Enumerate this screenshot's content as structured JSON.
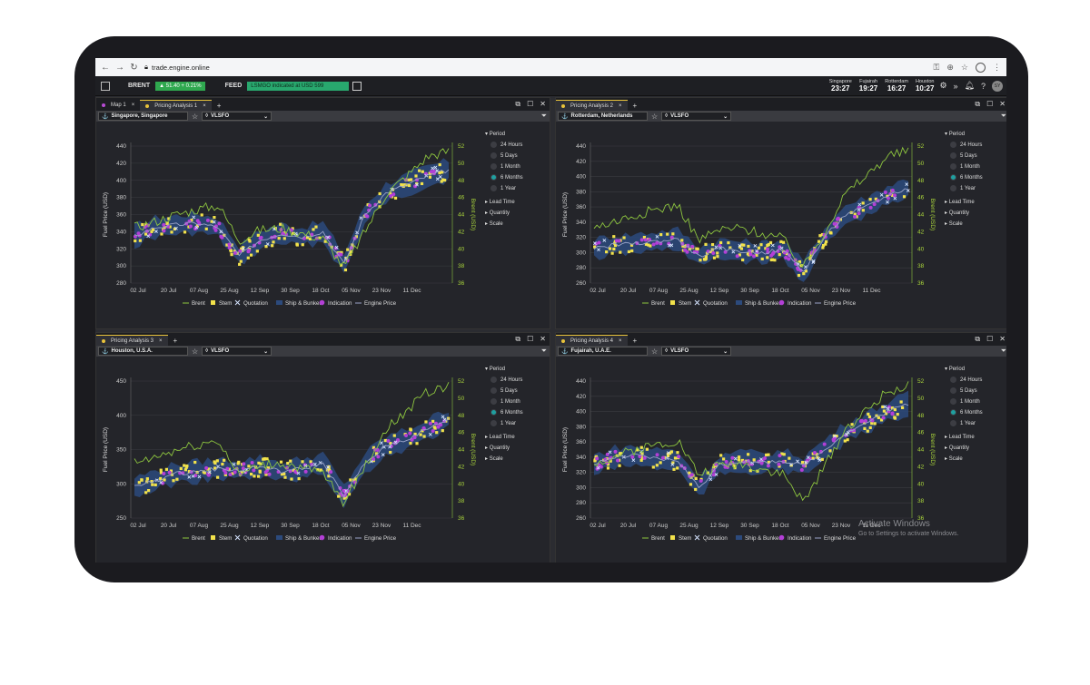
{
  "browser": {
    "url": "trade.engine.online"
  },
  "header": {
    "brent_label": "BRENT",
    "brent_value": "▲ 51.40   + 0.21%",
    "feed_label": "FEED",
    "feed_text": "LSMGO indicated at USD 599",
    "clocks": [
      {
        "city": "Singapore",
        "time": "23:27"
      },
      {
        "city": "Fujairah",
        "time": "19:27"
      },
      {
        "city": "Rotterdam",
        "time": "16:27"
      },
      {
        "city": "Houston",
        "time": "10:27"
      }
    ],
    "avatar_initials": "SY"
  },
  "side_panel": {
    "period_label": "Period",
    "period_options": [
      "24 Hours",
      "5 Days",
      "1 Month",
      "6 Months",
      "1 Year"
    ],
    "selected": "6 Months",
    "lead_time": "Lead Time",
    "quantity": "Quantity",
    "scale": "Scale"
  },
  "legend": [
    "Brent",
    "Stem",
    "Quotation",
    "Ship & Bunker",
    "Indication",
    "Engine Price"
  ],
  "colors": {
    "brent": "#8ec63f",
    "stem": "#f2e24b",
    "quotation": "#d6e4ff",
    "band": "#2c4a7c",
    "indication": "#b33fd6",
    "engine": "#9aa3c8"
  },
  "panels": [
    {
      "tabs": [
        {
          "label": "Map 1",
          "active": false
        },
        {
          "label": "Pricing Analysis 1",
          "active": true
        }
      ],
      "port": "Singapore, Singapore",
      "fuel": "VLSFO",
      "chart_data": {
        "type": "line",
        "x_ticks": [
          "02 Jul",
          "20 Jul",
          "07 Aug",
          "25 Aug",
          "12 Sep",
          "30 Sep",
          "18 Oct",
          "05 Nov",
          "23 Nov",
          "11 Dec"
        ],
        "ylabel": "Fuel Price (USD)",
        "ylim": [
          280,
          440
        ],
        "y_ticks": [
          "440",
          "420",
          "400",
          "380",
          "360",
          "340",
          "320",
          "300",
          "280"
        ],
        "y2label": "Brent (USD)",
        "y2lim": [
          36,
          52
        ],
        "y2_ticks": [
          "52",
          "50",
          "48",
          "46",
          "44",
          "42",
          "40",
          "38",
          "36"
        ],
        "series": [
          {
            "name": "Engine Price",
            "values": [
              335,
              345,
              348,
              350,
              345,
              312,
              330,
              338,
              334,
              340,
              302,
              360,
              385,
              395,
              405,
              412
            ]
          },
          {
            "name": "Brent",
            "values": [
              42.5,
              43.2,
              44.0,
              44.6,
              45.1,
              41.0,
              42.2,
              42.4,
              41.8,
              41.2,
              37.8,
              42.0,
              46.4,
              48.5,
              50.8,
              51.4
            ]
          }
        ]
      }
    },
    {
      "tabs": [
        {
          "label": "Pricing Analysis 2",
          "active": true
        }
      ],
      "port": "Rotterdam, Netherlands",
      "fuel": "VLSFO",
      "chart_data": {
        "type": "line",
        "x_ticks": [
          "02 Jul",
          "20 Jul",
          "07 Aug",
          "25 Aug",
          "12 Sep",
          "30 Sep",
          "18 Oct",
          "05 Nov",
          "23 Nov",
          "11 Dec"
        ],
        "ylabel": "Fuel Price (USD)",
        "ylim": [
          260,
          440
        ],
        "y_ticks": [
          "440",
          "420",
          "400",
          "380",
          "360",
          "340",
          "320",
          "300",
          "280",
          "260"
        ],
        "y2label": "Brent (USD)",
        "y2lim": [
          36,
          52
        ],
        "y2_ticks": [
          "52",
          "50",
          "48",
          "46",
          "44",
          "42",
          "40",
          "38",
          "36"
        ],
        "series": [
          {
            "name": "Engine Price",
            "values": [
              305,
              310,
              312,
              315,
              318,
              295,
              305,
              302,
              300,
              304,
              275,
              320,
              350,
              360,
              375,
              385
            ]
          },
          {
            "name": "Brent",
            "values": [
              42.5,
              43.2,
              44.0,
              44.6,
              45.1,
              41.0,
              42.2,
              42.4,
              41.8,
              41.2,
              37.8,
              42.0,
              46.4,
              48.5,
              50.8,
              51.4
            ]
          }
        ]
      }
    },
    {
      "tabs": [
        {
          "label": "Pricing Analysis 3",
          "active": true
        }
      ],
      "port": "Houston, U.S.A.",
      "fuel": "VLSFO",
      "chart_data": {
        "type": "line",
        "x_ticks": [
          "02 Jul",
          "20 Jul",
          "07 Aug",
          "25 Aug",
          "12 Sep",
          "30 Sep",
          "18 Oct",
          "05 Nov",
          "23 Nov",
          "11 Dec"
        ],
        "ylabel": "Fuel Price (USD)",
        "ylim": [
          250,
          450
        ],
        "y_ticks": [
          "450",
          "400",
          "350",
          "300",
          "250"
        ],
        "y2label": "Brent (USD)",
        "y2lim": [
          36,
          52
        ],
        "y2_ticks": [
          "52",
          "50",
          "48",
          "46",
          "44",
          "42",
          "40",
          "38",
          "36"
        ],
        "series": [
          {
            "name": "Engine Price",
            "values": [
              295,
              305,
              315,
              318,
              322,
              320,
              325,
              318,
              322,
              330,
              282,
              330,
              355,
              365,
              380,
              395
            ]
          },
          {
            "name": "Brent",
            "values": [
              42.5,
              43.2,
              44.0,
              44.6,
              45.1,
              41.0,
              42.2,
              42.4,
              41.8,
              41.2,
              37.8,
              42.0,
              46.4,
              48.5,
              50.8,
              51.4
            ]
          }
        ]
      }
    },
    {
      "tabs": [
        {
          "label": "Pricing Analysis 4",
          "active": true
        }
      ],
      "port": "Fujairah, U.A.E.",
      "fuel": "VLSFO",
      "chart_data": {
        "type": "line",
        "x_ticks": [
          "02 Jul",
          "20 Jul",
          "07 Aug",
          "25 Aug",
          "12 Sep",
          "30 Sep",
          "18 Oct",
          "05 Nov",
          "23 Nov",
          "11 Dec"
        ],
        "ylabel": "Fuel Price (USD)",
        "ylim": [
          260,
          440
        ],
        "y_ticks": [
          "440",
          "420",
          "400",
          "380",
          "360",
          "340",
          "320",
          "300",
          "280",
          "260"
        ],
        "y2label": "Brent (USD)",
        "y2lim": [
          36,
          52
        ],
        "y2_ticks": [
          "52",
          "50",
          "48",
          "46",
          "44",
          "42",
          "40",
          "38",
          "36"
        ],
        "series": [
          {
            "name": "Engine Price",
            "values": [
              330,
              340,
              342,
              338,
              336,
              300,
              330,
              335,
              332,
              336,
              328,
              350,
              372,
              385,
              400,
              410
            ]
          },
          {
            "name": "Brent",
            "values": [
              42.5,
              43.2,
              44.0,
              44.6,
              45.1,
              41.0,
              42.2,
              42.4,
              41.8,
              41.2,
              37.8,
              42.0,
              46.4,
              48.5,
              50.8,
              51.4
            ]
          }
        ]
      }
    }
  ],
  "watermark": {
    "title": "Activate Windows",
    "sub": "Go to Settings to activate Windows."
  }
}
